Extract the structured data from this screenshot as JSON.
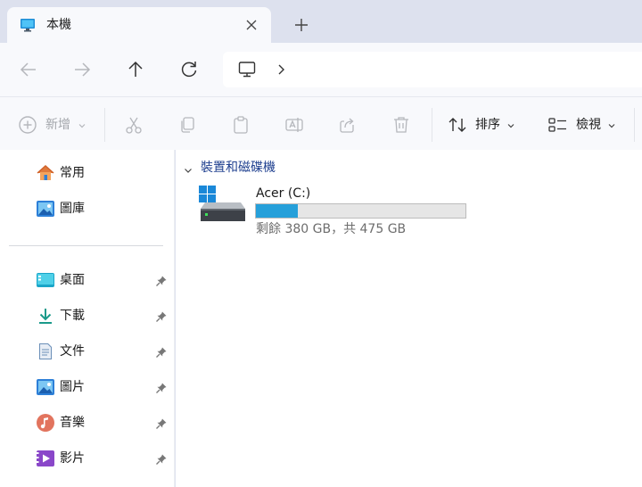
{
  "tab": {
    "title": "本機",
    "icon": "monitor-icon",
    "close_icon": "close-icon"
  },
  "new_tab": {
    "icon": "plus-icon"
  },
  "nav": {
    "back_icon": "arrow-left-icon",
    "forward_icon": "arrow-right-icon",
    "up_icon": "arrow-up-icon",
    "refresh_icon": "refresh-icon"
  },
  "address": {
    "location_icon": "monitor-outline-icon",
    "separator_icon": "chevron-right-icon"
  },
  "toolbar": {
    "new_label": "新增",
    "sort_label": "排序",
    "view_label": "檢視",
    "icons": [
      "cut-icon",
      "copy-icon",
      "paste-icon",
      "rename-icon",
      "share-icon",
      "delete-icon"
    ]
  },
  "sidebar": {
    "items": [
      {
        "label": "常用",
        "icon": "home-icon",
        "pinned": false
      },
      {
        "label": "圖庫",
        "icon": "gallery-icon",
        "pinned": false
      },
      {
        "label": "桌面",
        "icon": "desktop-icon",
        "pinned": true
      },
      {
        "label": "下載",
        "icon": "download-icon",
        "pinned": true
      },
      {
        "label": "文件",
        "icon": "documents-icon",
        "pinned": true
      },
      {
        "label": "圖片",
        "icon": "pictures-icon",
        "pinned": true
      },
      {
        "label": "音樂",
        "icon": "music-icon",
        "pinned": true
      },
      {
        "label": "影片",
        "icon": "videos-icon",
        "pinned": true
      }
    ]
  },
  "content": {
    "group_label": "裝置和磁碟機",
    "drive": {
      "name": "Acer (C:)",
      "free_text": "剩餘 380 GB，共 475 GB",
      "used_fraction": 0.2,
      "bar_color": "#26a0da"
    }
  },
  "colors": {
    "accent": "#26a0da",
    "group_header": "#1e3f8f",
    "tab_strip": "#dde1ee"
  }
}
